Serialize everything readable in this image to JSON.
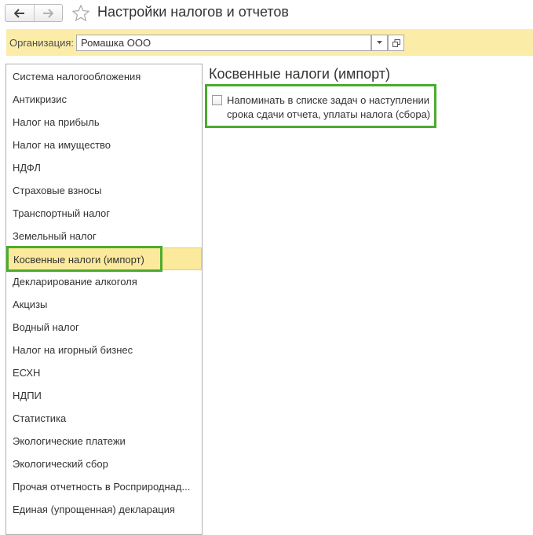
{
  "window": {
    "title": "Настройки налогов и отчетов"
  },
  "organization": {
    "label": "Организация:",
    "value": "Ромашка ООО"
  },
  "sidebar": {
    "items": [
      {
        "label": "Система налогообложения"
      },
      {
        "label": "Антикризис"
      },
      {
        "label": "Налог на прибыль"
      },
      {
        "label": "Налог на имущество"
      },
      {
        "label": "НДФЛ"
      },
      {
        "label": "Страховые взносы"
      },
      {
        "label": "Транспортный налог"
      },
      {
        "label": "Земельный налог"
      },
      {
        "label": "Косвенные налоги (импорт)",
        "selected": true
      },
      {
        "label": "Декларирование алкоголя"
      },
      {
        "label": "Акцизы"
      },
      {
        "label": "Водный налог"
      },
      {
        "label": "Налог на игорный бизнес"
      },
      {
        "label": "ЕСХН"
      },
      {
        "label": "НДПИ"
      },
      {
        "label": "Статистика"
      },
      {
        "label": "Экологические платежи"
      },
      {
        "label": "Экологический сбор"
      },
      {
        "label": "Прочая отчетность в Росприроднад..."
      },
      {
        "label": "Единая (упрощенная) декларация"
      }
    ]
  },
  "content": {
    "section_title": "Косвенные налоги (импорт)",
    "reminder_checkbox": {
      "checked": false,
      "label_line1": "Напоминать в списке задач о наступлении",
      "label_line2": "срока сдачи отчета, уплаты налога (сбора)"
    }
  },
  "colors": {
    "org_bar_bg": "#fbeca8",
    "selected_item_bg": "#fbe99c",
    "highlight_box": "#4cab2e"
  }
}
